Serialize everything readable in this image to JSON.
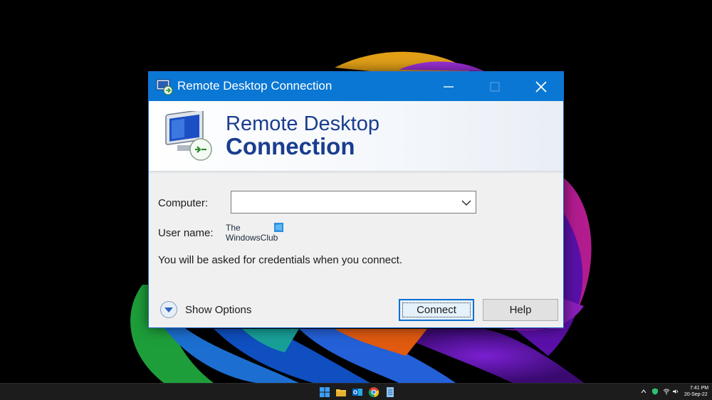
{
  "window": {
    "title": "Remote Desktop Connection",
    "banner_line1": "Remote Desktop",
    "banner_line2": "Connection"
  },
  "form": {
    "computer_label": "Computer:",
    "computer_value": "",
    "username_label": "User name:",
    "credentials_note": "You will be asked for credentials when you connect."
  },
  "watermark": {
    "line1": "The",
    "line2": "WindowsClub"
  },
  "buttons": {
    "show_options": "Show Options",
    "connect": "Connect",
    "help": "Help"
  },
  "taskbar": {
    "icons": [
      "start-icon",
      "file-explorer-icon",
      "outlook-icon",
      "chrome-icon",
      "notepad-icon"
    ],
    "tray_icons": [
      "chevron-up-icon",
      "shield-icon",
      "wifi-icon",
      "volume-icon"
    ],
    "time": "7:41 PM",
    "date": "20-Sep-22"
  },
  "colors": {
    "titlebar": "#0a77d4",
    "banner_text": "#1a3d8f",
    "focus_border": "#0a6fd0"
  }
}
